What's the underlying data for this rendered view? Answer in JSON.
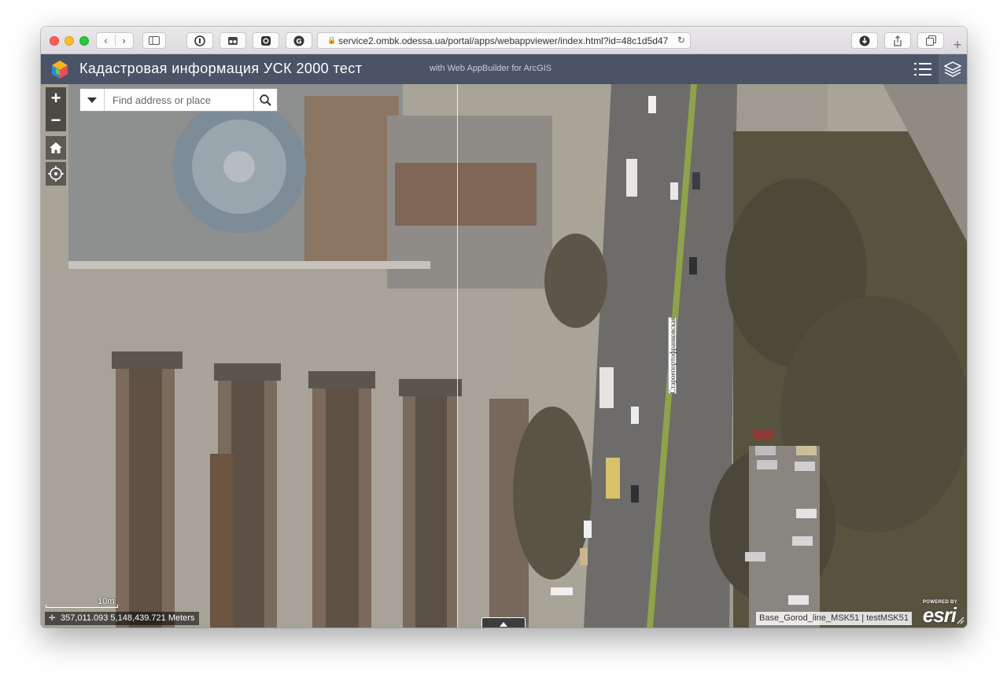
{
  "browser": {
    "url": "service2.ombk.odessa.ua/portal/apps/webappviewer/index.html?id=48c1d5d47",
    "back_glyph": "‹",
    "forward_glyph": "›",
    "new_tab_glyph": "+",
    "lock_icon": "lock-icon",
    "reload_icon": "reload-icon"
  },
  "app": {
    "title": "Кадастровая информация УСК 2000 тест",
    "subtitle": "with Web AppBuilder for ArcGIS",
    "header_bg": "#4a5466"
  },
  "map": {
    "zoom_in": "+",
    "zoom_out": "−",
    "search_placeholder": "Find address or place",
    "street_label": "Староепортофранковская",
    "scale_label": "10m",
    "coordinates": "357,011.093 5,148,439.721 Meters",
    "attribution": "Base_Gorod_line_MSK51 | testMSK51",
    "esri_powered": "POWERED BY",
    "esri_logo": "esri"
  }
}
